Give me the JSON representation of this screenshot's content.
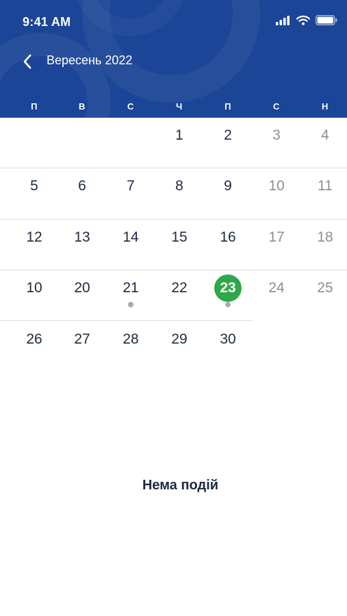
{
  "status_bar": {
    "time": "9:41 AM",
    "icons": [
      "signal-icon",
      "wifi-icon",
      "battery-icon"
    ]
  },
  "header": {
    "back_icon": "chevron-left-icon",
    "month_title": "Вересень 2022"
  },
  "weekdays": [
    "П",
    "В",
    "С",
    "Ч",
    "П",
    "С",
    "Н"
  ],
  "weeks": [
    [
      {
        "day": ""
      },
      {
        "day": ""
      },
      {
        "day": ""
      },
      {
        "day": "1"
      },
      {
        "day": "2"
      },
      {
        "day": "3",
        "weekend": true
      },
      {
        "day": "4",
        "weekend": true
      }
    ],
    [
      {
        "day": "5"
      },
      {
        "day": "6"
      },
      {
        "day": "7"
      },
      {
        "day": "8"
      },
      {
        "day": "9"
      },
      {
        "day": "10",
        "weekend": true
      },
      {
        "day": "11",
        "weekend": true
      }
    ],
    [
      {
        "day": "12"
      },
      {
        "day": "13"
      },
      {
        "day": "14"
      },
      {
        "day": "15"
      },
      {
        "day": "16"
      },
      {
        "day": "17",
        "weekend": true
      },
      {
        "day": "18",
        "weekend": true
      }
    ],
    [
      {
        "day": "10"
      },
      {
        "day": "20"
      },
      {
        "day": "21",
        "has_event": true
      },
      {
        "day": "22"
      },
      {
        "day": "23",
        "selected": true,
        "has_event": true
      },
      {
        "day": "24",
        "weekend": true
      },
      {
        "day": "25",
        "weekend": true
      }
    ],
    [
      {
        "day": "26"
      },
      {
        "day": "27"
      },
      {
        "day": "28"
      },
      {
        "day": "29"
      },
      {
        "day": "30"
      },
      {
        "day": ""
      },
      {
        "day": ""
      }
    ]
  ],
  "empty_state": {
    "message": "Нема подій"
  },
  "colors": {
    "header_bg": "#1b4596",
    "selected_day": "#2ea84a",
    "weekend_text": "#8a8f96",
    "event_dot": "#a9adb3"
  }
}
